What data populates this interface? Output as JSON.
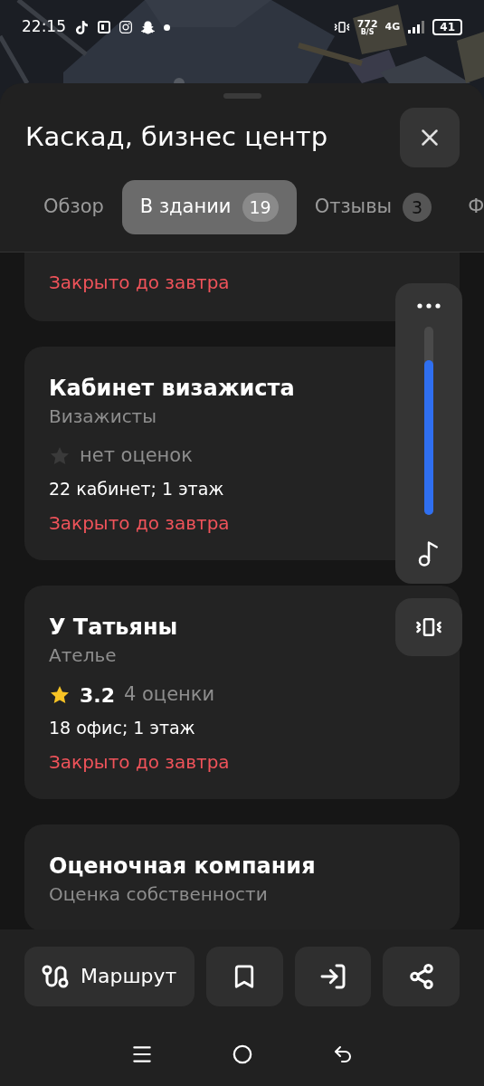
{
  "status_bar": {
    "time": "22:15",
    "speed": "772",
    "speed_unit": "B/S",
    "network": "4G",
    "battery": "41"
  },
  "sheet": {
    "title": "Каскад, бизнес центр"
  },
  "tabs": [
    {
      "label": "Обзор",
      "selected": false
    },
    {
      "label": "В здании",
      "count": "19",
      "selected": true
    },
    {
      "label": "Отзывы",
      "count": "3",
      "selected": false
    },
    {
      "label": "Ф",
      "selected": false
    }
  ],
  "places": [
    {
      "status": "Закрыто до завтра"
    },
    {
      "name": "Кабинет визажиста",
      "category": "Визажисты",
      "rated": false,
      "rating_text": "нет оценок",
      "location": "22 кабинет; 1 этаж",
      "status": "Закрыто до завтра"
    },
    {
      "name": "У Татьяны",
      "category": "Ателье",
      "rated": true,
      "rating": "3.2",
      "rating_text": "4 оценки",
      "location": "18 офис; 1 этаж",
      "status": "Закрыто до завтра"
    },
    {
      "name": "Оценочная компания",
      "category": "Оценка собственности"
    }
  ],
  "volume": {
    "level": 0.82
  },
  "actions": {
    "route": "Маршрут"
  }
}
